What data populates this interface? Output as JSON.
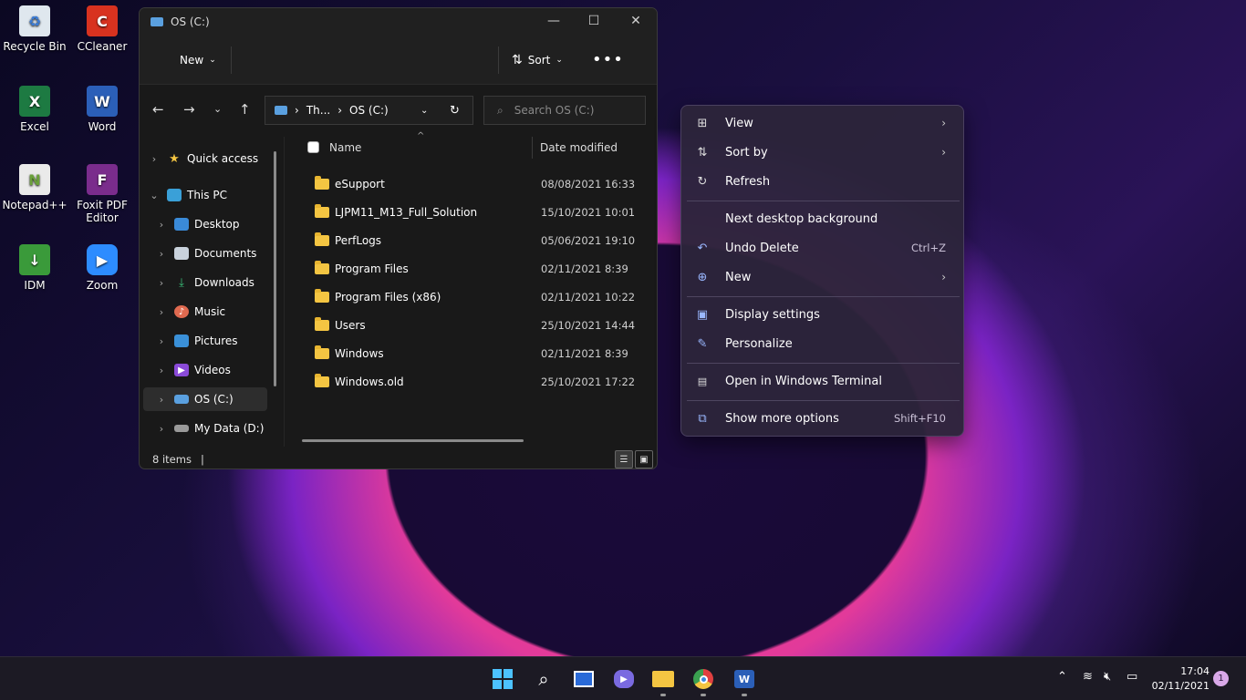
{
  "desktop": {
    "icons": [
      {
        "label": "Recycle Bin",
        "icon": "recycle-bin-icon"
      },
      {
        "label": "CCleaner",
        "icon": "ccleaner-icon"
      },
      {
        "label": "Excel",
        "icon": "excel-icon"
      },
      {
        "label": "Word",
        "icon": "word-icon"
      },
      {
        "label": "Notepad++",
        "icon": "notepad-plus-plus-icon"
      },
      {
        "label": "Foxit PDF Editor",
        "icon": "foxit-pdf-icon"
      },
      {
        "label": "IDM",
        "icon": "idm-icon"
      },
      {
        "label": "Zoom",
        "icon": "zoom-icon"
      }
    ]
  },
  "explorer": {
    "title": "OS (C:)",
    "cmdbar": {
      "new_label": "New",
      "sort_label": "Sort"
    },
    "address": {
      "crumb1": "Th...",
      "crumb2": "OS (C:)"
    },
    "search": {
      "placeholder": "Search OS (C:)"
    },
    "nav": {
      "quick_access": "Quick access",
      "this_pc": "This PC",
      "desktop": "Desktop",
      "documents": "Documents",
      "downloads": "Downloads",
      "music": "Music",
      "pictures": "Pictures",
      "videos": "Videos",
      "os_c": "OS (C:)",
      "my_data": "My Data (D:)"
    },
    "columns": {
      "name": "Name",
      "date": "Date modified"
    },
    "files": [
      {
        "name": "eSupport",
        "date": "08/08/2021 16:33"
      },
      {
        "name": "LJPM11_M13_Full_Solution",
        "date": "15/10/2021 10:01"
      },
      {
        "name": "PerfLogs",
        "date": "05/06/2021 19:10"
      },
      {
        "name": "Program Files",
        "date": "02/11/2021 8:39"
      },
      {
        "name": "Program Files (x86)",
        "date": "02/11/2021 10:22"
      },
      {
        "name": "Users",
        "date": "25/10/2021 14:44"
      },
      {
        "name": "Windows",
        "date": "02/11/2021 8:39"
      },
      {
        "name": "Windows.old",
        "date": "25/10/2021 17:22"
      }
    ],
    "status": "8 items"
  },
  "context_menu": {
    "view": "View",
    "sort_by": "Sort by",
    "refresh": "Refresh",
    "next_bg": "Next desktop background",
    "undo_delete": "Undo Delete",
    "undo_shortcut": "Ctrl+Z",
    "new": "New",
    "display_settings": "Display settings",
    "personalize": "Personalize",
    "open_terminal": "Open in Windows Terminal",
    "show_more": "Show more options",
    "show_more_shortcut": "Shift+F10"
  },
  "taskbar": {
    "time": "17:04",
    "date": "02/11/2021",
    "notifications": "1"
  }
}
